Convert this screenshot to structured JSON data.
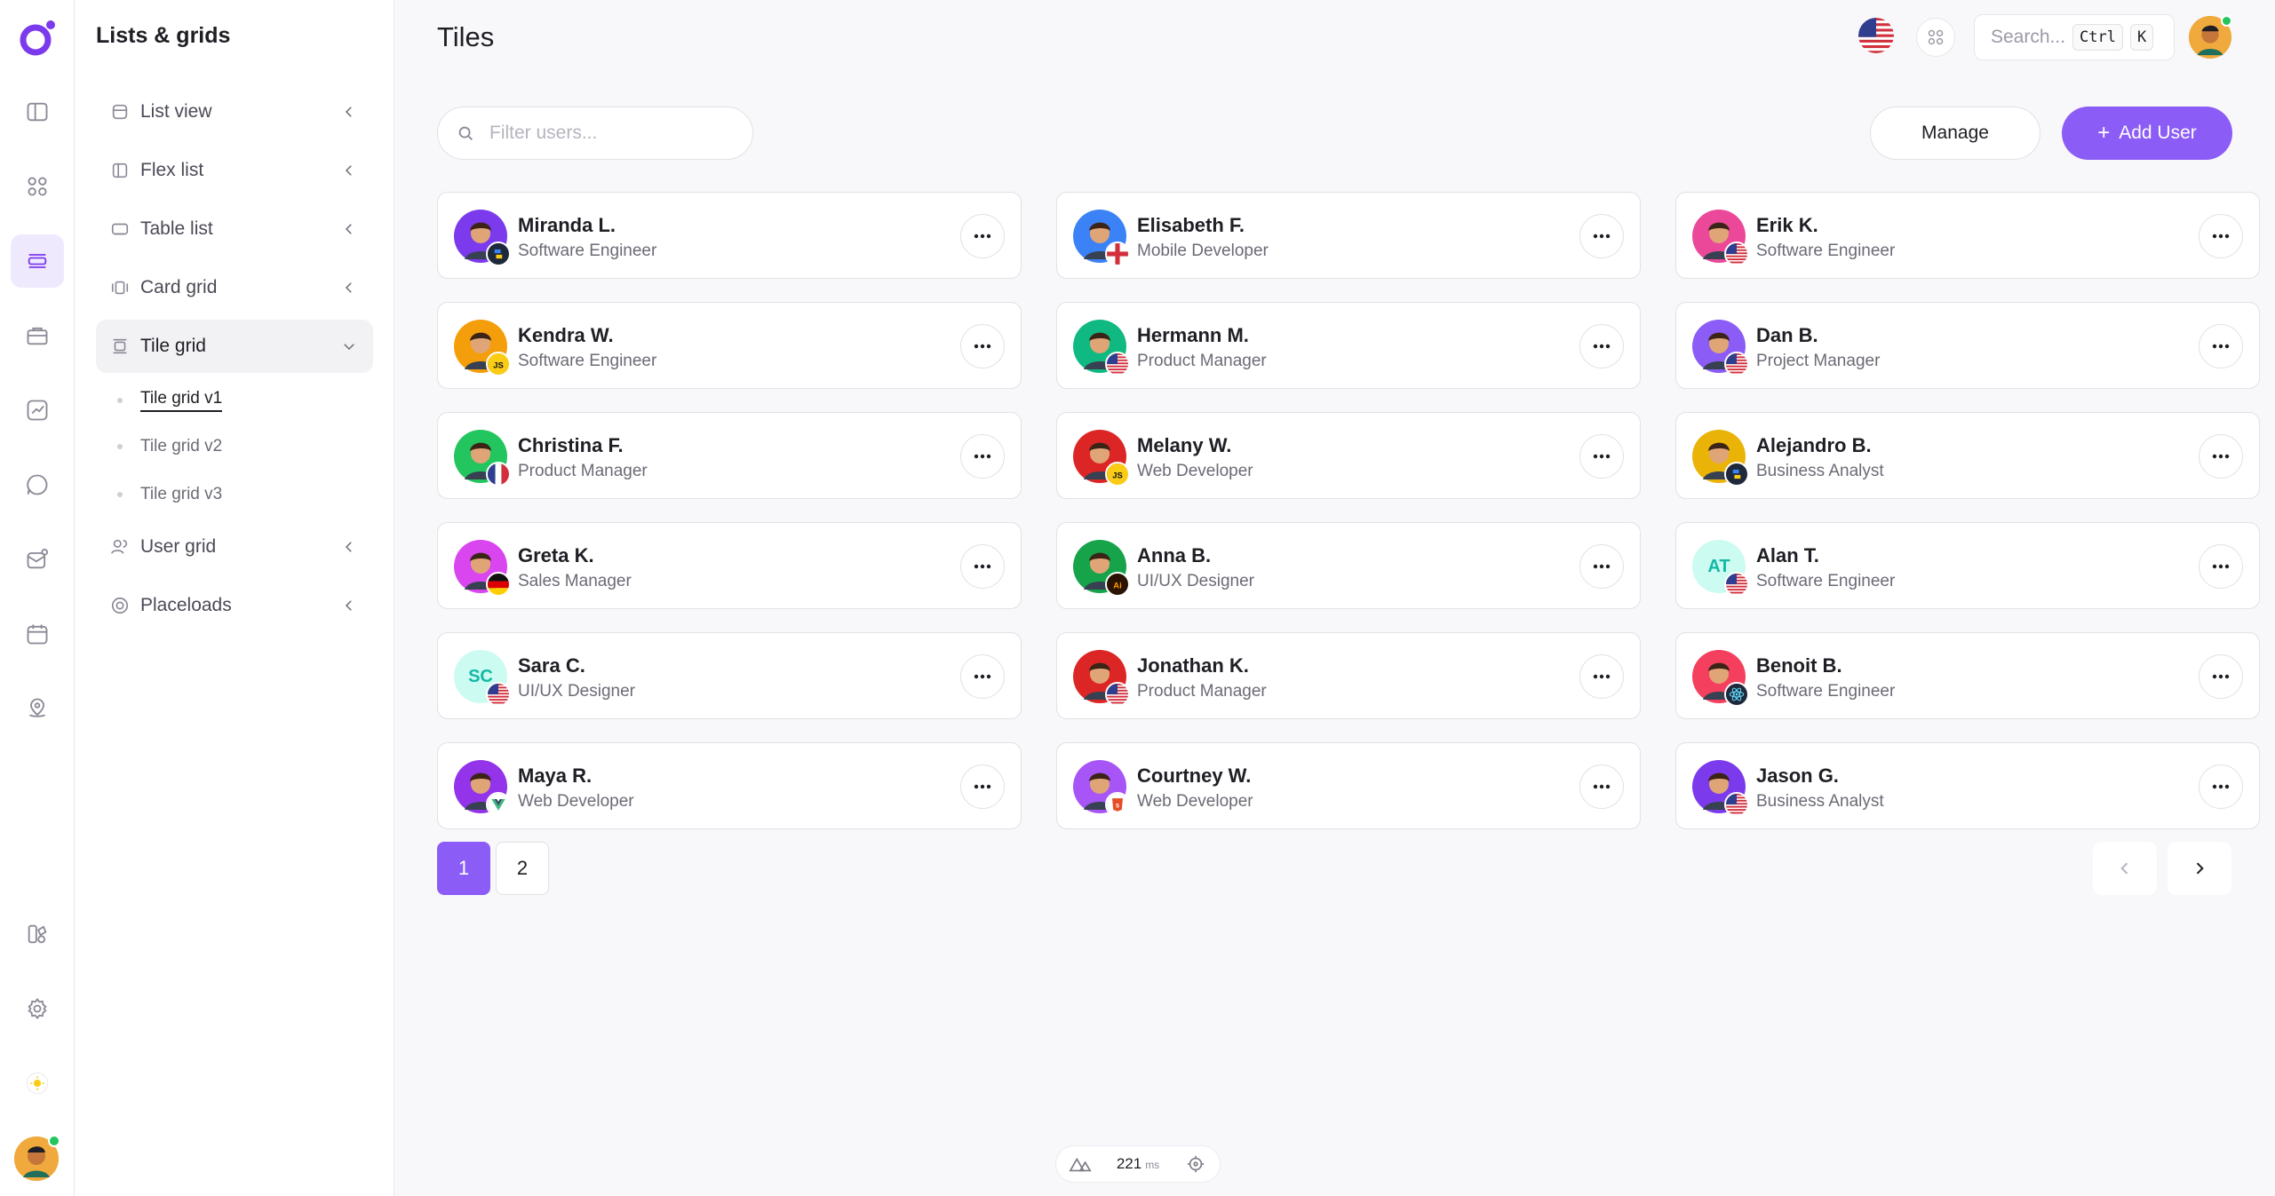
{
  "sidebar": {
    "title": "Lists & grids",
    "items": [
      {
        "label": "List view"
      },
      {
        "label": "Flex list"
      },
      {
        "label": "Table list"
      },
      {
        "label": "Card grid"
      },
      {
        "label": "Tile grid"
      },
      {
        "label": "User grid"
      },
      {
        "label": "Placeloads"
      }
    ],
    "subitems": [
      {
        "label": "Tile grid v1"
      },
      {
        "label": "Tile grid v2"
      },
      {
        "label": "Tile grid v3"
      }
    ]
  },
  "header": {
    "title": "Tiles",
    "search_placeholder": "Search...",
    "kbd1": "Ctrl",
    "kbd2": "K"
  },
  "toolbar": {
    "filter_placeholder": "Filter users...",
    "manage_label": "Manage",
    "add_label": "Add User"
  },
  "users": [
    {
      "name": "Miranda L.",
      "role": "Software Engineer"
    },
    {
      "name": "Elisabeth F.",
      "role": "Mobile Developer"
    },
    {
      "name": "Erik K.",
      "role": "Software Engineer"
    },
    {
      "name": "Kendra W.",
      "role": "Software Engineer"
    },
    {
      "name": "Hermann M.",
      "role": "Product Manager"
    },
    {
      "name": "Dan B.",
      "role": "Project Manager"
    },
    {
      "name": "Christina F.",
      "role": "Product Manager"
    },
    {
      "name": "Melany W.",
      "role": "Web Developer"
    },
    {
      "name": "Alejandro B.",
      "role": "Business Analyst"
    },
    {
      "name": "Greta K.",
      "role": "Sales Manager"
    },
    {
      "name": "Anna B.",
      "role": "UI/UX Designer"
    },
    {
      "name": "Alan T.",
      "role": "Software Engineer",
      "initials": "AT"
    },
    {
      "name": "Sara C.",
      "role": "UI/UX Designer",
      "initials": "SC"
    },
    {
      "name": "Jonathan K.",
      "role": "Product Manager"
    },
    {
      "name": "Benoit B.",
      "role": "Software Engineer"
    },
    {
      "name": "Maya R.",
      "role": "Web Developer"
    },
    {
      "name": "Courtney W.",
      "role": "Web Developer"
    },
    {
      "name": "Jason G.",
      "role": "Business Analyst"
    }
  ],
  "pagination": {
    "pages": [
      "1",
      "2"
    ],
    "current": "1"
  },
  "perf": {
    "value": "221",
    "unit": "ms"
  },
  "colors": {
    "accent": "#8b5cf6"
  }
}
